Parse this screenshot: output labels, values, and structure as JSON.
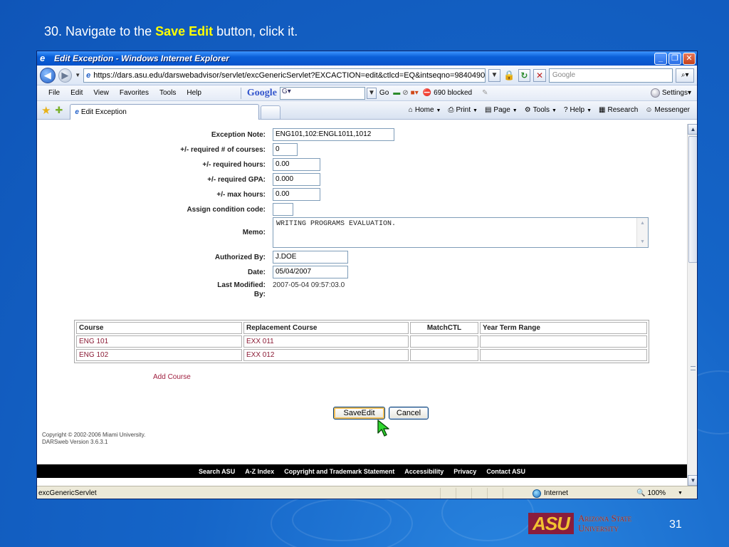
{
  "slide": {
    "instruction_prefix": "30. Navigate to the ",
    "instruction_highlight": "Save Edit",
    "instruction_suffix": " button, click it.",
    "number": "31",
    "logo_line1": "Arizona State",
    "logo_line2": "University",
    "logo_mark": "ASU"
  },
  "window": {
    "title": "Edit Exception - Windows Internet Explorer",
    "minimize": "_",
    "maximize": "❐",
    "close": "✕"
  },
  "address": {
    "url": "https://dars.asu.edu/darswebadvisor/servlet/excGenericServlet?EXCACTION=edit&ctlcd=EQ&intseqno=98404909&a",
    "search_placeholder": "Google"
  },
  "menu": {
    "items": [
      "File",
      "Edit",
      "View",
      "Favorites",
      "Tools",
      "Help"
    ],
    "google_logo": "Google",
    "google_input": "G▾",
    "go": "Go",
    "blocked": "690 blocked",
    "settings": "Settings▾"
  },
  "tabs": {
    "active_tab": "Edit Exception",
    "home": "Home",
    "print": "Print",
    "page": "Page",
    "tools": "Tools",
    "help": "Help",
    "research": "Research",
    "messenger": "Messenger"
  },
  "form": {
    "exception_note_label": "Exception Note:",
    "exception_note_value": "ENG101,102:ENGL1011,1012",
    "req_courses_label": "+/- required # of courses:",
    "req_courses_value": "0",
    "req_hours_label": "+/- required hours:",
    "req_hours_value": "0.00",
    "req_gpa_label": "+/- required GPA:",
    "req_gpa_value": "0.000",
    "max_hours_label": "+/- max hours:",
    "max_hours_value": "0.00",
    "condition_code_label": "Assign condition code:",
    "condition_code_value": "",
    "memo_label": "Memo:",
    "memo_value": "WRITING PROGRAMS EVALUATION.",
    "authorized_label": "Authorized By:",
    "authorized_value": "J.DOE",
    "date_label": "Date:",
    "date_value": "05/04/2007",
    "last_modified_label_1": "Last Modified:",
    "last_modified_label_2": "By:",
    "last_modified_value": "2007-05-04 09:57:03.0"
  },
  "course_table": {
    "headers": [
      "Course",
      "Replacement Course",
      "MatchCTL",
      "Year Term Range"
    ],
    "rows": [
      [
        "ENG 101",
        "EXX 011",
        "",
        ""
      ],
      [
        "ENG 102",
        "EXX 012",
        "",
        ""
      ]
    ]
  },
  "actions": {
    "add_course": "Add Course",
    "save_edit": "SaveEdit",
    "cancel": "Cancel"
  },
  "footer": {
    "copyright_line1": "Copyright © 2002-2006 Miami University.",
    "copyright_line2": "DARSweb Version 3.6.3.1",
    "links": [
      "Search ASU",
      "A-Z Index",
      "Copyright and Trademark Statement",
      "Accessibility",
      "Privacy",
      "Contact ASU"
    ]
  },
  "status": {
    "text": "excGenericServlet",
    "zone": "Internet",
    "zoom": "100%"
  },
  "colors": {
    "slide_bg": "#1565c8",
    "highlight": "#ffff00",
    "link_maroon": "#8b1c36",
    "asu_maroon": "#8a1d3c",
    "asu_gold": "#f2c230"
  }
}
